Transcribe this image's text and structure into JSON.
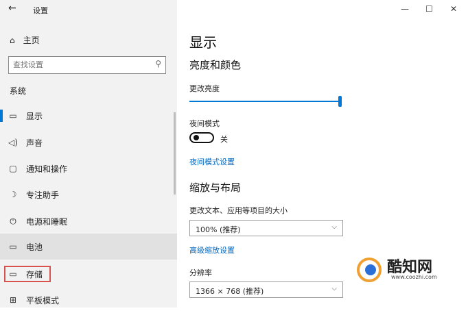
{
  "window": {
    "title": "设置",
    "controls": {
      "minimize": "—",
      "maximize": "☐",
      "close": "✕"
    }
  },
  "sidebar": {
    "home_label": "主页",
    "search_placeholder": "查找设置",
    "section_label": "系统",
    "items": [
      {
        "label": "显示",
        "icon": "monitor-icon",
        "glyph": "▭"
      },
      {
        "label": "声音",
        "icon": "speaker-icon",
        "glyph": "◁)"
      },
      {
        "label": "通知和操作",
        "icon": "notification-icon",
        "glyph": "▢"
      },
      {
        "label": "专注助手",
        "icon": "moon-icon",
        "glyph": "☽"
      },
      {
        "label": "电源和睡眠",
        "icon": "power-icon",
        "glyph": "⏻"
      },
      {
        "label": "电池",
        "icon": "battery-icon",
        "glyph": "▭"
      },
      {
        "label": "存储",
        "icon": "storage-icon",
        "glyph": "▭"
      },
      {
        "label": "平板模式",
        "icon": "tablet-icon",
        "glyph": "⊞"
      }
    ]
  },
  "main": {
    "page_title": "显示",
    "section1": "亮度和颜色",
    "brightness_label": "更改亮度",
    "brightness_value": 1.0,
    "night_mode_label": "夜间模式",
    "night_mode_state": "关",
    "night_mode_link": "夜间模式设置",
    "section2": "缩放与布局",
    "scale_label": "更改文本、应用等项目的大小",
    "scale_value": "100% (推荐)",
    "advanced_scale_link": "高级缩放设置",
    "resolution_label": "分辨率",
    "resolution_value": "1366 × 768 (推荐)"
  },
  "watermark": {
    "name": "酷知网",
    "url": "www.coozhi.com"
  },
  "colors": {
    "accent": "#0078d7",
    "link": "#0067c0",
    "highlight_border": "#d9534f",
    "sidebar_bg": "#f2f2f2"
  }
}
